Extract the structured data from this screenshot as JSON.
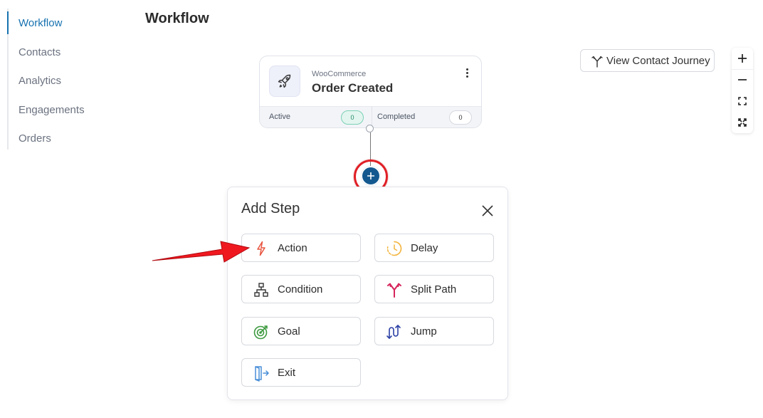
{
  "sidebar": {
    "items": [
      {
        "label": "Workflow",
        "active": true
      },
      {
        "label": "Contacts",
        "active": false
      },
      {
        "label": "Analytics",
        "active": false
      },
      {
        "label": "Engagements",
        "active": false
      },
      {
        "label": "Orders",
        "active": false
      }
    ]
  },
  "page": {
    "title": "Workflow"
  },
  "trigger": {
    "source": "WooCommerce",
    "name": "Order Created",
    "icon": "rocket-icon",
    "stats": {
      "active_label": "Active",
      "active_count": "0",
      "completed_label": "Completed",
      "completed_count": "0"
    }
  },
  "toolbar": {
    "view_journey_label": "View Contact Journey"
  },
  "add_step": {
    "title": "Add Step",
    "steps": [
      {
        "label": "Action",
        "icon": "lightning-icon"
      },
      {
        "label": "Delay",
        "icon": "clock-icon"
      },
      {
        "label": "Condition",
        "icon": "hierarchy-icon"
      },
      {
        "label": "Split Path",
        "icon": "split-path-icon"
      },
      {
        "label": "Goal",
        "icon": "target-icon"
      },
      {
        "label": "Jump",
        "icon": "jump-icon"
      },
      {
        "label": "Exit",
        "icon": "exit-door-icon"
      }
    ]
  },
  "colors": {
    "accent": "#1772b0",
    "add_button": "#13598f",
    "highlight": "#e01f26",
    "action_icon": "#e8553e",
    "delay_icon": "#f3b53f",
    "split_icon": "#d6245b",
    "goal_icon": "#3d9a3f",
    "jump_icon": "#2a3fa5",
    "exit_icon": "#4a8fd8"
  }
}
